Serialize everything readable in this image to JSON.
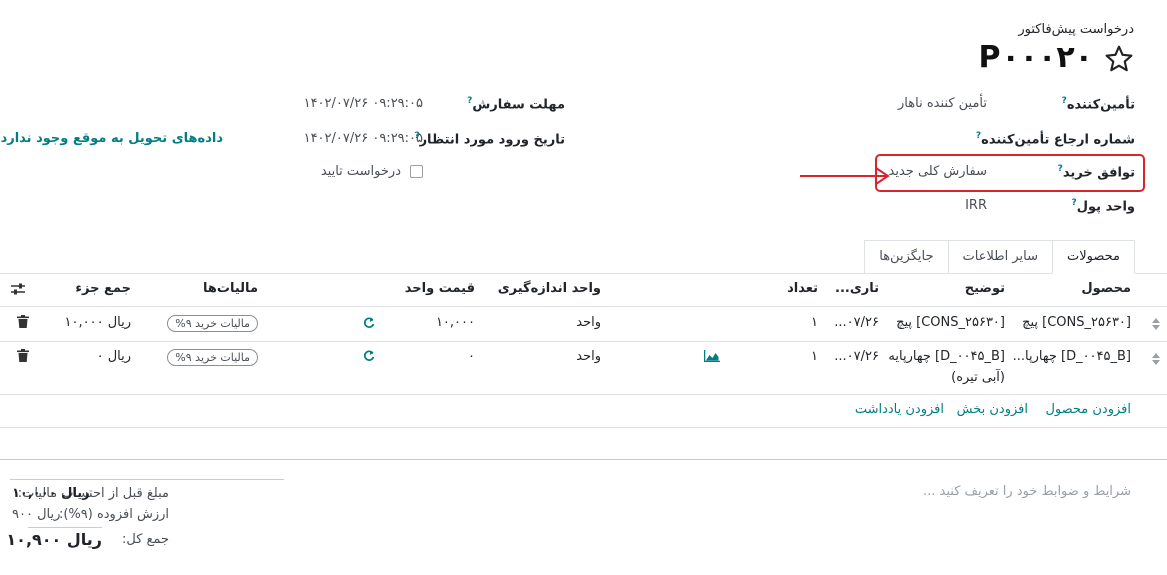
{
  "header": {
    "doc_kind": "درخواست پیش‌فاکتور",
    "title": "P۰۰۰۲۰",
    "star_icon": "star-outline-icon"
  },
  "fields_right": {
    "vendor_label": "تأمین‌کننده",
    "vendor_value": "تأمین کننده ناهار",
    "vendor_ref_label": "شماره ارجاع تأمین‌کننده",
    "agreement_label": "توافق خرید",
    "agreement_value": "سفارش کلی جدید",
    "currency_label": "واحد پول",
    "currency_value": "IRR",
    "help_mark": "?"
  },
  "fields_mid": {
    "deadline_label": "مهلت سفارش",
    "deadline_value": "۱۴۰۲/۰۷/۲۶ ۰۹:۲۹:۰۵",
    "expected_label": "تاریخ ورود مورد انتظار",
    "expected_value": "۱۴۰۲/۰۷/۲۶ ۰۹:۲۹:۰۵",
    "confirm_label": "درخواست تایید",
    "help_mark": "?"
  },
  "delivery_link": "داده‌های تحویل به موقع وجود ندارد",
  "tabs": [
    {
      "label": "محصولات",
      "active": true
    },
    {
      "label": "سایر اطلاعات",
      "active": false
    },
    {
      "label": "جایگزین‌ها",
      "active": false
    }
  ],
  "table": {
    "headers": {
      "product": "محصول",
      "description": "توضیح",
      "date": "تاری...",
      "qty": "تعداد",
      "uom": "واحد اندازه‌گیری",
      "price": "قیمت واحد",
      "taxes": "مالیات‌ها",
      "subtotal": "جمع جزء"
    },
    "rows": [
      {
        "product": "[CONS_۲۵۶۳۰] پیچ",
        "description": "[CONS_۲۵۶۳۰] پیچ",
        "description2": "",
        "date": "...۰۷/۲۶",
        "qty": "۱",
        "uom": "واحد",
        "price": "۱۰,۰۰۰",
        "tax": "مالیات خرید ۹%",
        "subtotal": "ریال ۱۰,۰۰۰"
      },
      {
        "product": "[D_۰۰۴۵_B] چهارپا...",
        "description": "[D_۰۰۴۵_B] چهارپایه",
        "description2": "(آبی تیره)",
        "date": "...۰۷/۲۶",
        "qty": "۱",
        "uom": "واحد",
        "price": "۰",
        "tax": "مالیات خرید ۹%",
        "subtotal": "ریال ۰"
      }
    ],
    "add_product": "افزودن محصول",
    "add_section": "افزودن بخش",
    "add_note": "افزودن یادداشت"
  },
  "footer": {
    "terms_placeholder": "شرایط و ضوابط خود را تعریف کنید ...",
    "untaxed_label": "مبلغ قبل از احتساب مالیات:",
    "untaxed_value": "ریال ۱۰,۰۰۰",
    "vat_label": "ارزش افزوده (۹%):",
    "vat_value": "ریال ۹۰۰",
    "total_label": "جمع کل:",
    "total_value": "ریال ۱۰,۹۰۰"
  },
  "colors": {
    "accent": "#017e84",
    "highlight": "#d9232d"
  }
}
